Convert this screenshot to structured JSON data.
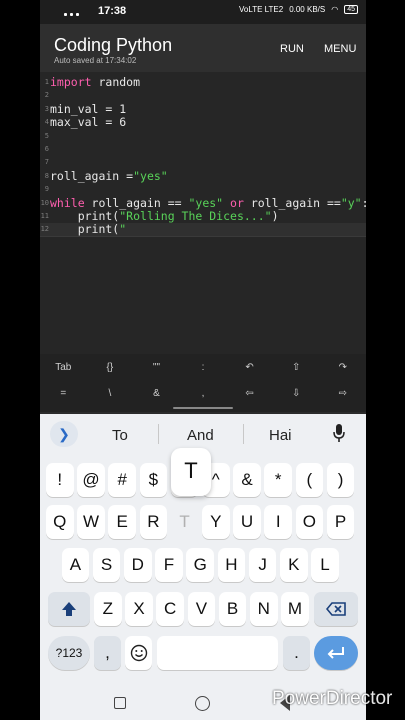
{
  "status_bar": {
    "time": "17:38",
    "net_label": "VoLTE LTE2",
    "speed": "0.00 KB/S",
    "battery": "45"
  },
  "app": {
    "title": "Coding Python",
    "subtitle": "Auto saved at 17:34:02",
    "run_label": "RUN",
    "menu_label": "MENU"
  },
  "editor": {
    "lines": [
      {
        "n": "1",
        "text": ""
      },
      {
        "n": "2",
        "text": ""
      },
      {
        "n": "3",
        "text": "min_val = 1"
      },
      {
        "n": "4",
        "text": "max_val = 6"
      },
      {
        "n": "5",
        "text": ""
      },
      {
        "n": "6",
        "text": ""
      },
      {
        "n": "7",
        "text": ""
      },
      {
        "n": "8",
        "text": ""
      },
      {
        "n": "9",
        "text": ""
      },
      {
        "n": "10",
        "text": ""
      },
      {
        "n": "11",
        "text": ""
      },
      {
        "n": "12",
        "text": ""
      }
    ],
    "line1_kw": "import",
    "line1_rest": " random",
    "line8_a": "roll_again =",
    "line8_str": "\"yes\"",
    "line10_kw": "while",
    "line10_a": " roll_again == ",
    "line10_str1": "\"yes\"",
    "line10_or": " or ",
    "line10_b": "roll_again ==",
    "line10_str2": "\"y\"",
    "line10_c": ":",
    "line11_fn": "    print(",
    "line11_str": "\"Rolling The Dices...\"",
    "line11_end": ")",
    "line12_fn": "    print(",
    "line12_str": "\""
  },
  "extra_keys": {
    "row1": [
      "Tab",
      "{}",
      "\"\"",
      ":",
      "↶",
      "⇧",
      "↷"
    ],
    "row2": [
      "=",
      "\\",
      "&",
      ",",
      "⇦",
      "⇩",
      "⇨"
    ]
  },
  "keyboard": {
    "suggestions": [
      "To",
      "And",
      "Hai"
    ],
    "symbols_row": [
      "!",
      "@",
      "#",
      "$",
      "%",
      "^",
      "&",
      "*",
      "(",
      ")"
    ],
    "row1": [
      "Q",
      "W",
      "E",
      "R",
      "T",
      "Y",
      "U",
      "I",
      "O",
      "P"
    ],
    "row2": [
      "A",
      "S",
      "D",
      "F",
      "G",
      "H",
      "J",
      "K",
      "L"
    ],
    "row3": [
      "Z",
      "X",
      "C",
      "V",
      "B",
      "N",
      "M"
    ],
    "popup_key": "T",
    "numbers_label": "?123",
    "comma": ",",
    "period": "."
  },
  "watermark": "PowerDirector",
  "colors": {
    "keyword": "#ff5faf",
    "string": "#59d359",
    "accent": "#5b9be0"
  }
}
